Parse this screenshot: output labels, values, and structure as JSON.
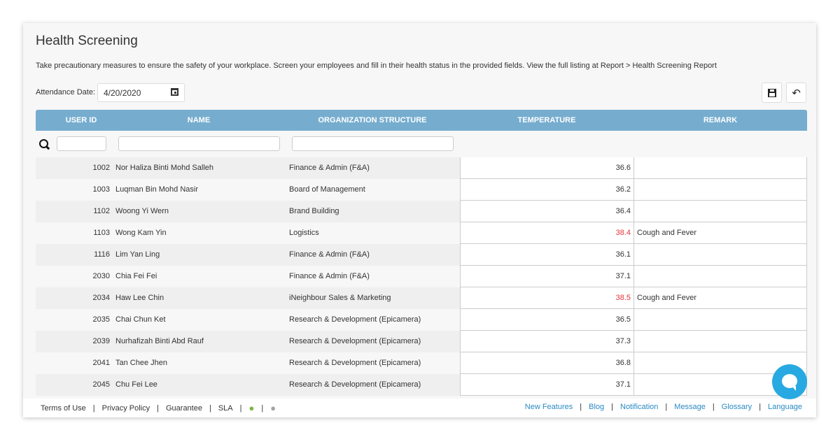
{
  "title": "Health Screening",
  "description": "Take precautionary measures to ensure the safety of your workplace. Screen your employees and fill in their health status in the provided fields. View the full listing at Report > Health Screening Report",
  "attendance": {
    "label": "Attendance Date:",
    "value": "4/20/2020"
  },
  "columns": [
    "USER ID",
    "NAME",
    "ORGANIZATION STRUCTURE",
    "TEMPERATURE",
    "REMARK"
  ],
  "colors": {
    "header": "#76adcf",
    "fever": "#e8343a",
    "link": "#2a8ac4",
    "chat": "#29a9e1"
  },
  "rows": [
    {
      "id": "1002",
      "name": "Nor Haliza Binti Mohd Salleh",
      "org": "Finance & Admin (F&A)",
      "temp": "36.6",
      "remark": ""
    },
    {
      "id": "1003",
      "name": "Luqman Bin Mohd Nasir",
      "org": "Board of Management",
      "temp": "36.2",
      "remark": ""
    },
    {
      "id": "1102",
      "name": "Woong Yi Wern",
      "org": "Brand Building",
      "temp": "36.4",
      "remark": ""
    },
    {
      "id": "1103",
      "name": "Wong Kam Yin",
      "org": "Logistics",
      "temp": "38.4",
      "remark": "Cough and Fever"
    },
    {
      "id": "1116",
      "name": "Lim Yan Ling",
      "org": "Finance & Admin (F&A)",
      "temp": "36.1",
      "remark": ""
    },
    {
      "id": "2030",
      "name": "Chia Fei Fei",
      "org": "Finance & Admin (F&A)",
      "temp": "37.1",
      "remark": ""
    },
    {
      "id": "2034",
      "name": "Haw Lee Chin",
      "org": "iNeighbour Sales & Marketing",
      "temp": "38.5",
      "remark": "Cough and Fever"
    },
    {
      "id": "2035",
      "name": "Chai Chun Ket",
      "org": "Research & Development (Epicamera)",
      "temp": "36.5",
      "remark": ""
    },
    {
      "id": "2039",
      "name": "Nurhafizah Binti Abd Rauf",
      "org": "Research & Development (Epicamera)",
      "temp": "37.3",
      "remark": ""
    },
    {
      "id": "2041",
      "name": "Tan Chee Jhen",
      "org": "Research & Development (Epicamera)",
      "temp": "36.8",
      "remark": ""
    },
    {
      "id": "2045",
      "name": "Chu Fei Lee",
      "org": "Research & Development (Epicamera)",
      "temp": "37.1",
      "remark": ""
    }
  ],
  "footer": {
    "left": [
      "Terms of Use",
      "Privacy Policy",
      "Guarantee",
      "SLA"
    ],
    "right": [
      "New Features",
      "Blog",
      "Notification",
      "Message",
      "Glossary",
      "Language"
    ]
  }
}
